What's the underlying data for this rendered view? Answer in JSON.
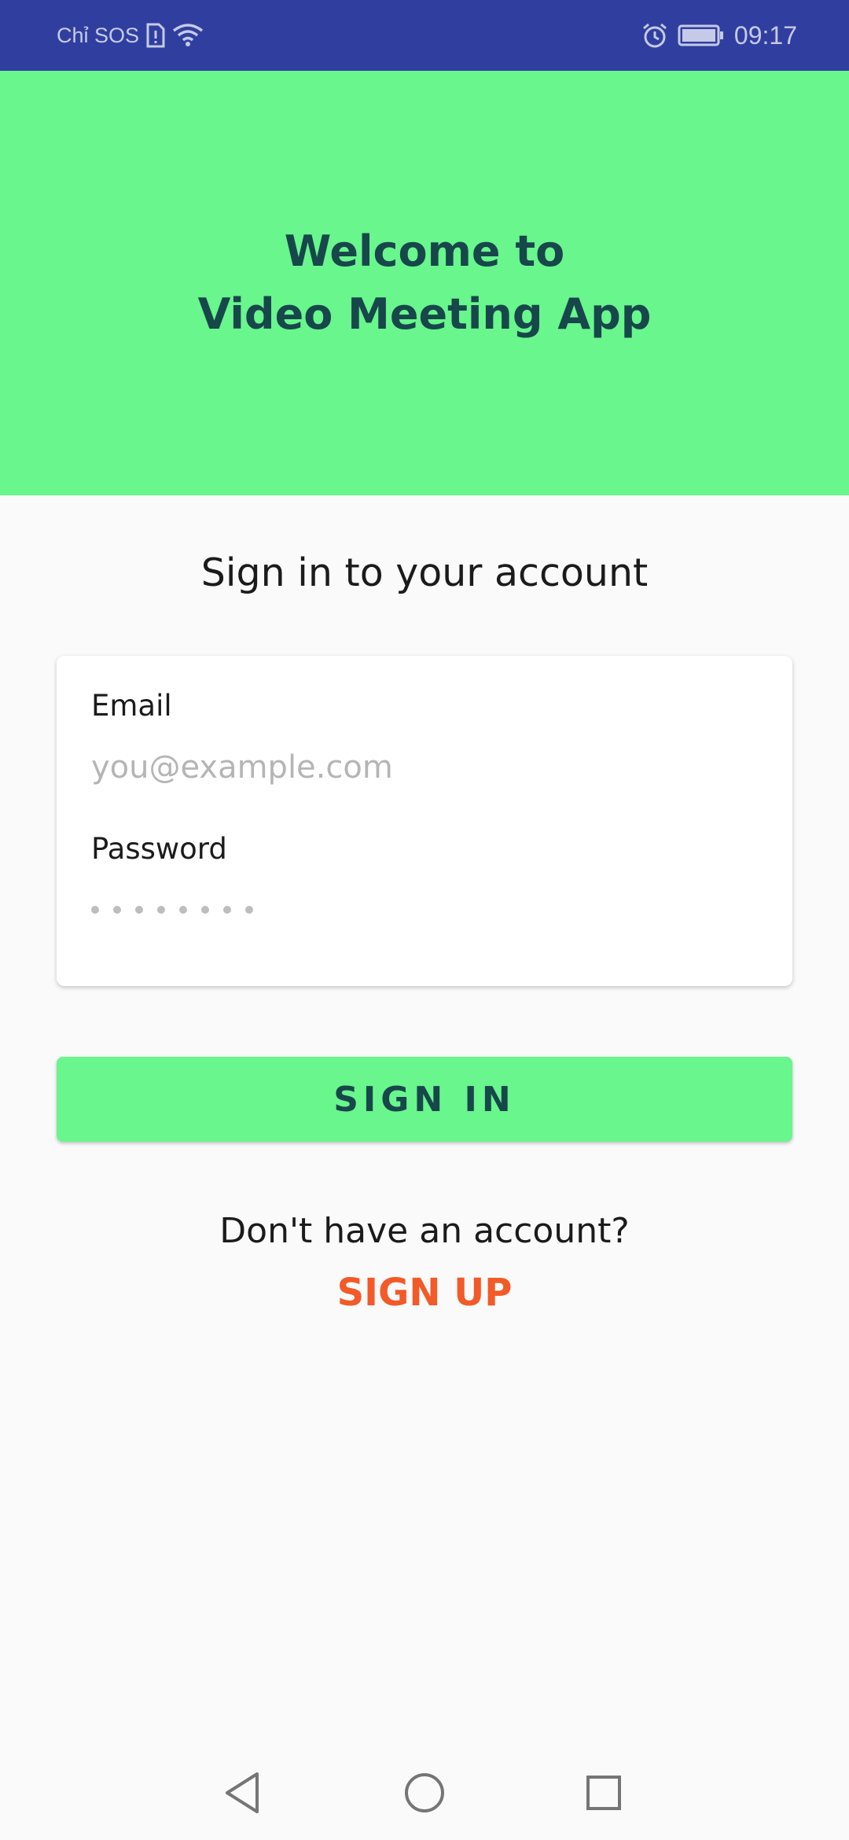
{
  "status_bar": {
    "carrier": "Chỉ SOS",
    "time": "09:17",
    "icons": [
      "sim-alert-icon",
      "wifi-icon",
      "alarm-icon",
      "battery-icon"
    ]
  },
  "header": {
    "line1": "Welcome to",
    "line2": "Video Meeting App"
  },
  "form": {
    "subtitle": "Sign in to your account",
    "email_label": "Email",
    "email_placeholder": "you@example.com",
    "email_value": "",
    "password_label": "Password",
    "password_placeholder": "••••••••",
    "sign_in_label": "SIGN IN",
    "no_account_text": "Don't have an account?",
    "sign_up_label": "SIGN UP"
  },
  "colors": {
    "status_bar": "#303f9f",
    "accent_green": "#68f68d",
    "dark_teal_text": "#17474a",
    "sign_up_orange": "#f25a28",
    "background": "#fafafa"
  },
  "nav_bar": {
    "icons": [
      "back-icon",
      "home-icon",
      "recents-icon"
    ]
  }
}
